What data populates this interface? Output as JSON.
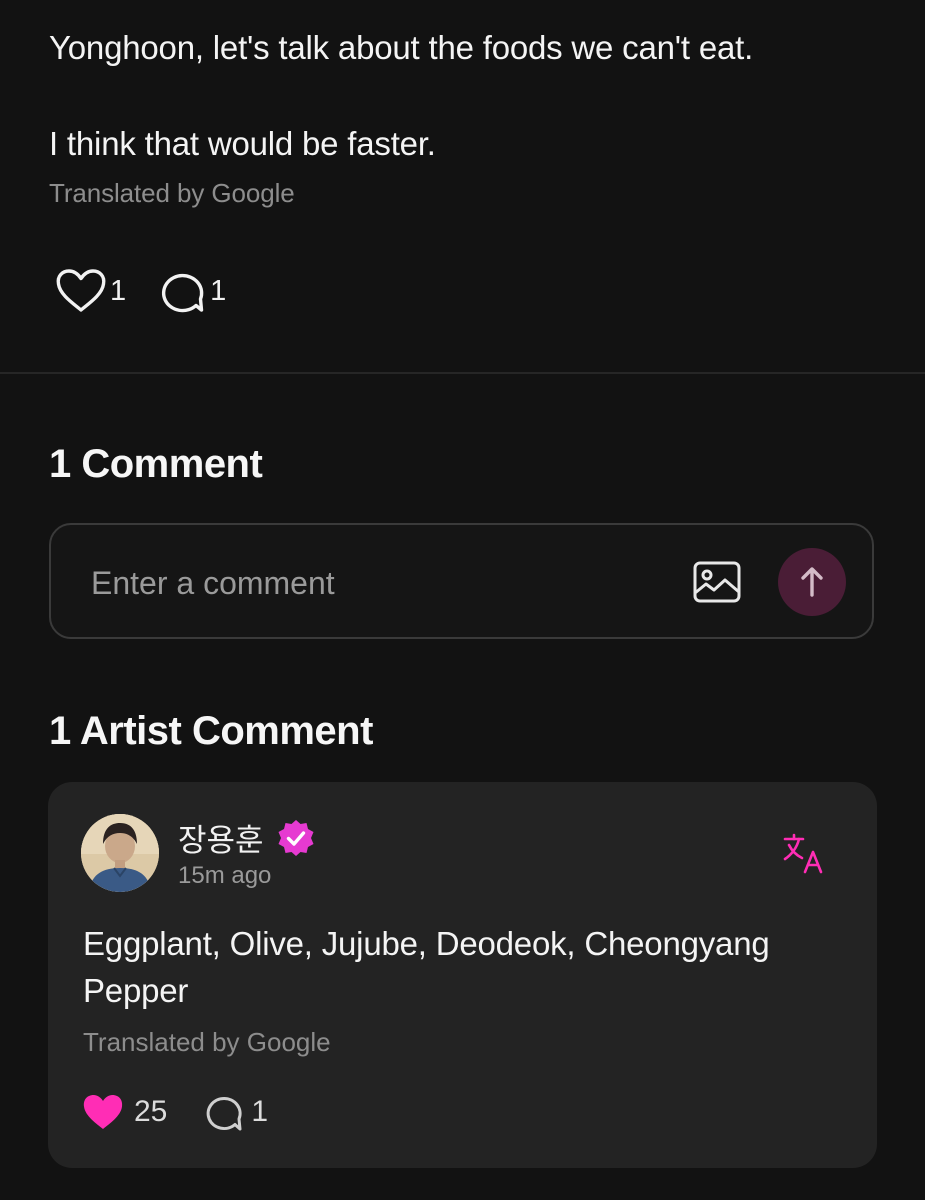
{
  "post": {
    "lines": [
      "Yonghoon, let's talk about the foods we can't eat.",
      "I think that would be faster."
    ],
    "translated": "Translated by Google",
    "likes": "1",
    "comments": "1"
  },
  "comments_section": {
    "title": "1 Comment",
    "input_placeholder": "Enter a comment"
  },
  "artist_section": {
    "title": "1 Artist Comment",
    "comment": {
      "author": "장용훈",
      "time": "15m ago",
      "text": "Eggplant, Olive, Jujube, Deodeok, Cheongyang Pepper",
      "translated": "Translated by Google",
      "likes": "25",
      "replies": "1"
    }
  },
  "icons": {
    "like": "heart-outline-icon",
    "comment": "speech-bubble-icon",
    "image": "image-icon",
    "send": "arrow-up-icon",
    "verified": "verified-badge-icon",
    "translate": "translate-icon",
    "liked": "heart-filled-icon"
  },
  "colors": {
    "background": "#121212",
    "card": "#232323",
    "accent_pink": "#ff2db5",
    "send_button": "#4a1d36",
    "secondary_text": "#8d8d8d"
  }
}
